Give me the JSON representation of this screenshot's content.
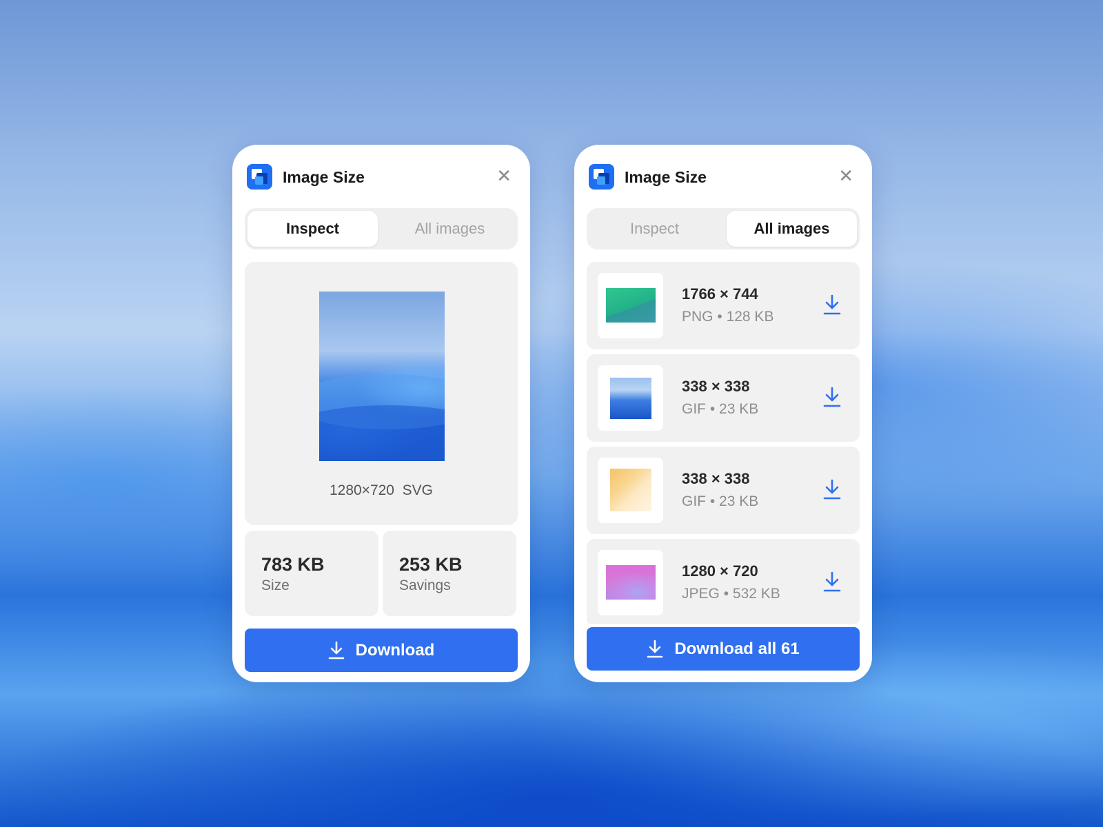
{
  "app": {
    "title": "Image Size",
    "accent_color": "#2f6ff0",
    "logo_icon": "image-size-logo-icon",
    "close_icon": "close-icon"
  },
  "left_panel": {
    "tabs": [
      {
        "label": "Inspect",
        "active": true
      },
      {
        "label": "All images",
        "active": false
      }
    ],
    "preview": {
      "caption": "1280×720  SVG"
    },
    "stats": [
      {
        "value": "783 KB",
        "label": "Size"
      },
      {
        "value": "253 KB",
        "label": "Savings"
      }
    ],
    "button": {
      "label": "Download",
      "icon": "download-icon"
    }
  },
  "right_panel": {
    "tabs": [
      {
        "label": "Inspect",
        "active": false
      },
      {
        "label": "All images",
        "active": true
      }
    ],
    "images": [
      {
        "dimensions": "1766 × 744",
        "format": "PNG",
        "size": "128 KB"
      },
      {
        "dimensions": "338 × 338",
        "format": "GIF",
        "size": "23 KB"
      },
      {
        "dimensions": "338 × 338",
        "format": "GIF",
        "size": "23 KB"
      },
      {
        "dimensions": "1280 × 720",
        "format": "JPEG",
        "size": "532 KB"
      }
    ],
    "meta_separator": "•",
    "button": {
      "label": "Download all 61",
      "icon": "download-icon"
    }
  }
}
